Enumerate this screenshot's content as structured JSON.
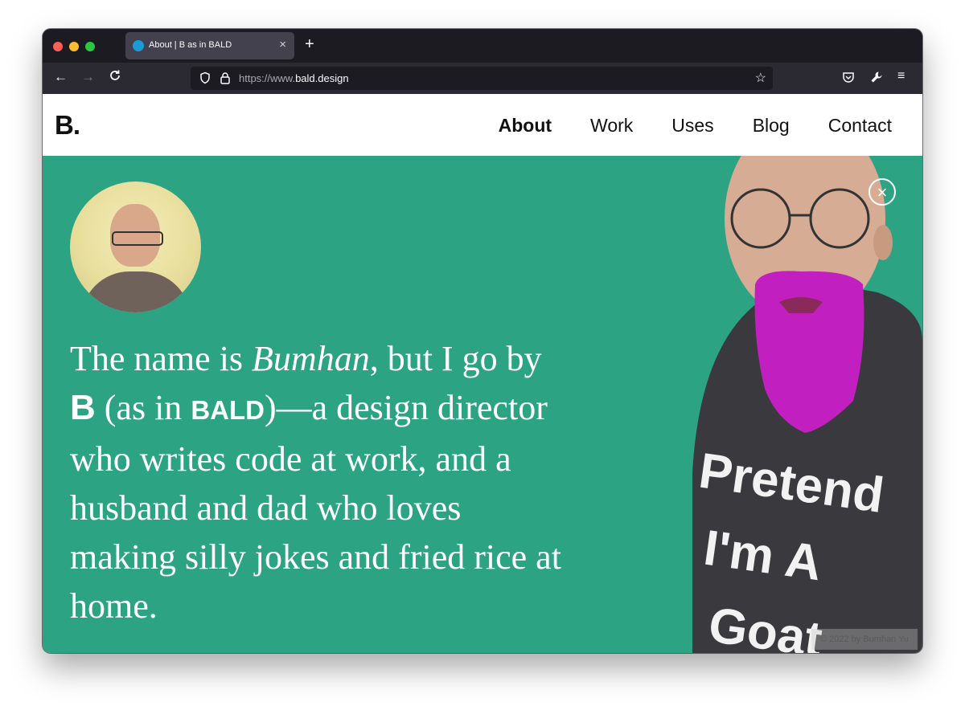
{
  "browser": {
    "tab": {
      "title": "About | B as in BALD"
    },
    "url": {
      "prefix": "https://www.",
      "domain": "bald.design"
    },
    "icons": [
      "back-icon",
      "forward-icon",
      "reload-icon",
      "shield-icon",
      "lock-icon",
      "bookmark-star-icon",
      "pocket-icon",
      "wrench-icon",
      "menu-icon",
      "close-icon",
      "plus-icon"
    ]
  },
  "site": {
    "logo": "B.",
    "nav": [
      {
        "label": "About",
        "active": true
      },
      {
        "label": "Work"
      },
      {
        "label": "Uses"
      },
      {
        "label": "Blog"
      },
      {
        "label": "Contact"
      }
    ]
  },
  "hero": {
    "intro": {
      "p1": "The name is ",
      "name": "Bumhan",
      "p2": ", but I go by ",
      "b": "B",
      "p3": " (as in ",
      "bald": "BALD",
      "p4": ")—a design director who writes code at work, and a husband and dad who loves making silly jokes and fried rice at home."
    },
    "shirt_text": [
      "Pretend",
      "I'm A",
      "Goat"
    ],
    "credit": "© 2022 by Bumhan Yu",
    "colors": {
      "hero_bg": "#2ca383",
      "beard": "#c11fbf"
    }
  }
}
